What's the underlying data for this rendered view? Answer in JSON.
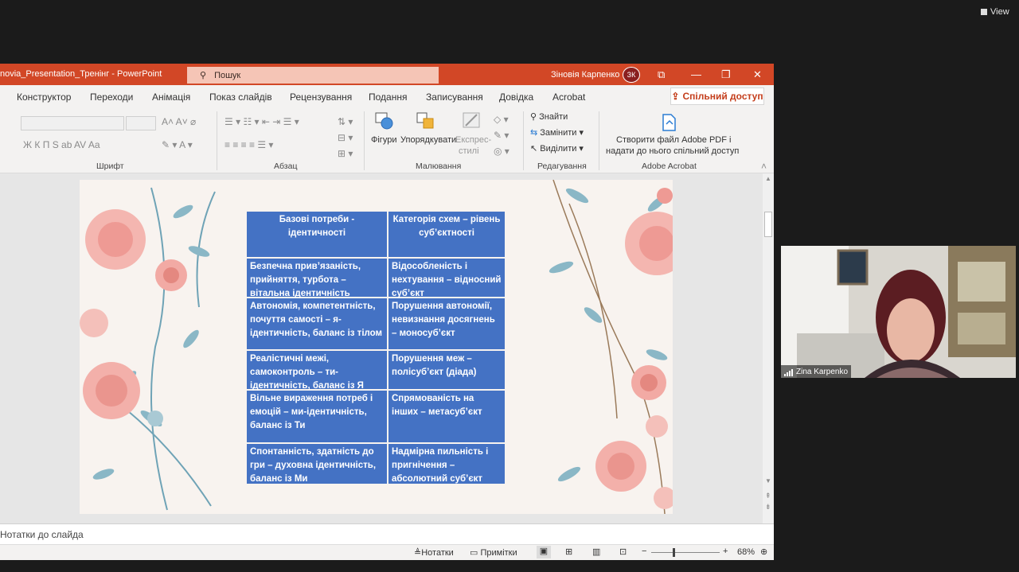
{
  "zoom": {
    "view_label": "View"
  },
  "window": {
    "title": "novia_Presentation_Тренінг  -  PowerPoint",
    "search_placeholder": "Пошук",
    "user_name": "Зіновія Карпенко",
    "user_initials": "ЗК"
  },
  "tabs": [
    "Конструктор",
    "Переходи",
    "Анімація",
    "Показ слайдів",
    "Рецензування",
    "Подання",
    "Записування",
    "Довідка",
    "Acrobat"
  ],
  "share_label": "Спільний доступ",
  "ribbon": {
    "font_group": "Шрифт",
    "paragraph_group": "Абзац",
    "drawing_group": "Малювання",
    "editing_group": "Редагування",
    "acrobat_group": "Adobe Acrobat",
    "shapes": "Фігури",
    "arrange": "Упорядкувати",
    "express_styles_1": "Експрес-",
    "express_styles_2": "стилі",
    "find": "Знайти",
    "replace": "Замінити",
    "select": "Виділити",
    "acrobat_line1": "Створити файл Adobe PDF і",
    "acrobat_line2": "надати до нього спільний доступ",
    "font_format": "Ж  К  П  S  ab  AV  Aa"
  },
  "table": {
    "headers": [
      "Базові потреби  - ідентичності",
      "Категорія схем – рівень суб’єктності"
    ],
    "rows": [
      [
        "Безпечна прив’язаність, прийняття, турбота – вітальна ідентичність",
        "Відособленість і нехтування – відносний суб’єкт"
      ],
      [
        "Автономія, компетентність, почуття самості – я-ідентичність, баланс із тілом",
        "Порушення автономії, невизнання досягнень – моносуб’єкт"
      ],
      [
        "Реалістичні межі, самоконтроль – ти-ідентичність, баланс із Я",
        "Порушення меж – полісуб’єкт (діада)"
      ],
      [
        "Вільне вираження потреб і емоцій – ми-ідентичність, баланс із Ти",
        "Спрямованість на інших – метасуб’єкт"
      ],
      [
        "Спонтанність, здатність до гри – духовна ідентичність, баланс із Ми",
        "Надмірна пильність і пригнічення – абсолютний суб’єкт"
      ]
    ]
  },
  "notes_placeholder": "Нотатки до слайда",
  "statusbar": {
    "notes": "Нотатки",
    "comments": "Примітки",
    "zoom": "68%"
  },
  "video": {
    "participant": "Zina Karpenko"
  },
  "colors": {
    "ppt_accent": "#d24726",
    "table_blue": "#4472c4"
  }
}
